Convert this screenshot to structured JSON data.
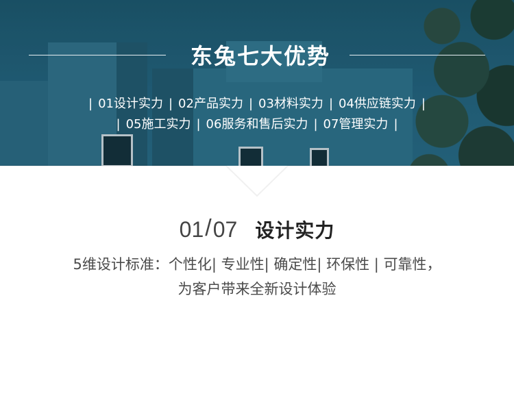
{
  "header": {
    "title": "东兔七大优势"
  },
  "nav": {
    "row1": [
      "01设计实力",
      "02产品实力",
      "03材料实力",
      "04供应链实力"
    ],
    "row2": [
      "05施工实力",
      "06服务和售后实力",
      "07管理实力"
    ],
    "separator": "|"
  },
  "section": {
    "current": "01",
    "slash": "/",
    "total": "07",
    "title": "设计实力",
    "description_line1": "5维设计标准：个性化| 专业性| 确定性| 环保性 | 可靠性，",
    "description_line2": "为客户带来全新设计体验"
  },
  "colors": {
    "hero_blue": "#23607a",
    "text_dark": "#222222",
    "text_body": "#4a4a4a",
    "white": "#ffffff"
  }
}
